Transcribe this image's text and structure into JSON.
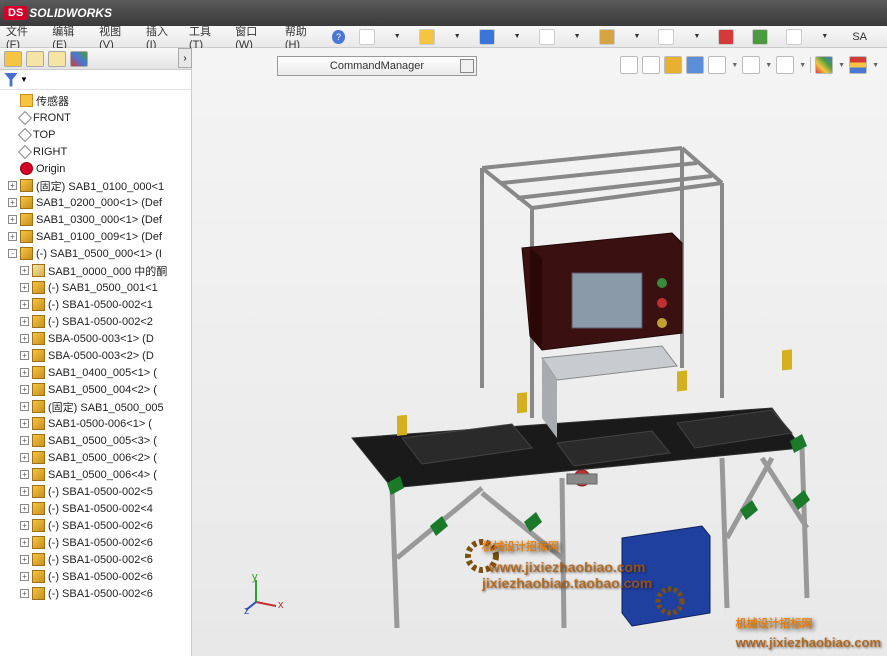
{
  "app": {
    "brand_prefix": "DS",
    "brand": "SOLIDWORKS",
    "doc_suffix": "SA"
  },
  "menu": {
    "file": "文件(F)",
    "edit": "编辑(E)",
    "view": "视图(V)",
    "insert": "插入(I)",
    "tools": "工具(T)",
    "window": "窗口(W)",
    "help": "帮助(H)"
  },
  "command_manager": {
    "label": "CommandManager"
  },
  "tree": {
    "items": [
      {
        "indent": 0,
        "exp": "",
        "icon": "sensor",
        "label": "传感器"
      },
      {
        "indent": 0,
        "exp": "",
        "icon": "plane",
        "label": "FRONT"
      },
      {
        "indent": 0,
        "exp": "",
        "icon": "plane",
        "label": "TOP"
      },
      {
        "indent": 0,
        "exp": "",
        "icon": "plane",
        "label": "RIGHT"
      },
      {
        "indent": 0,
        "exp": "",
        "icon": "origin",
        "label": "Origin"
      },
      {
        "indent": 0,
        "exp": "+",
        "icon": "part",
        "label": "(固定) SAB1_0100_000<1"
      },
      {
        "indent": 0,
        "exp": "+",
        "icon": "part",
        "label": "SAB1_0200_000<1> (Def"
      },
      {
        "indent": 0,
        "exp": "+",
        "icon": "part",
        "label": "SAB1_0300_000<1> (Def"
      },
      {
        "indent": 0,
        "exp": "+",
        "icon": "part",
        "label": "SAB1_0100_009<1> (Def"
      },
      {
        "indent": 0,
        "exp": "-",
        "icon": "part",
        "label": "(-) SAB1_0500_000<1> (I"
      },
      {
        "indent": 1,
        "exp": "+",
        "icon": "assem",
        "label": "SAB1_0000_000 中的酮"
      },
      {
        "indent": 1,
        "exp": "+",
        "icon": "part",
        "label": "(-) SAB1_0500_001<1"
      },
      {
        "indent": 1,
        "exp": "+",
        "icon": "part",
        "label": "(-) SBA1-0500-002<1"
      },
      {
        "indent": 1,
        "exp": "+",
        "icon": "part",
        "label": "(-) SBA1-0500-002<2"
      },
      {
        "indent": 1,
        "exp": "+",
        "icon": "part",
        "label": "SBA-0500-003<1> (D"
      },
      {
        "indent": 1,
        "exp": "+",
        "icon": "part",
        "label": "SBA-0500-003<2> (D"
      },
      {
        "indent": 1,
        "exp": "+",
        "icon": "part",
        "label": "SAB1_0400_005<1> ("
      },
      {
        "indent": 1,
        "exp": "+",
        "icon": "part",
        "label": "SAB1_0500_004<2> ("
      },
      {
        "indent": 1,
        "exp": "+",
        "icon": "part",
        "label": "(固定) SAB1_0500_005"
      },
      {
        "indent": 1,
        "exp": "+",
        "icon": "part",
        "label": "SAB1-0500-006<1> ("
      },
      {
        "indent": 1,
        "exp": "+",
        "icon": "part",
        "label": "SAB1_0500_005<3> ("
      },
      {
        "indent": 1,
        "exp": "+",
        "icon": "part",
        "label": "SAB1_0500_006<2> ("
      },
      {
        "indent": 1,
        "exp": "+",
        "icon": "part",
        "label": "SAB1_0500_006<4> ("
      },
      {
        "indent": 1,
        "exp": "+",
        "icon": "part",
        "label": "(-) SBA1-0500-002<5"
      },
      {
        "indent": 1,
        "exp": "+",
        "icon": "part",
        "label": "(-) SBA1-0500-002<4"
      },
      {
        "indent": 1,
        "exp": "+",
        "icon": "part",
        "label": "(-) SBA1-0500-002<6"
      },
      {
        "indent": 1,
        "exp": "+",
        "icon": "part",
        "label": "(-) SBA1-0500-002<6"
      },
      {
        "indent": 1,
        "exp": "+",
        "icon": "part",
        "label": "(-) SBA1-0500-002<6"
      },
      {
        "indent": 1,
        "exp": "+",
        "icon": "part",
        "label": "(-) SBA1-0500-002<6"
      },
      {
        "indent": 1,
        "exp": "+",
        "icon": "part",
        "label": "(-) SBA1-0500-002<6"
      }
    ]
  },
  "coord": {
    "x": "x",
    "y": "y",
    "z": "z"
  },
  "watermark": {
    "main": "机械设计招标网",
    "url1": "www.jixiezhaobiao.com",
    "url2": "jixiezhaobiao.taobao.com"
  }
}
